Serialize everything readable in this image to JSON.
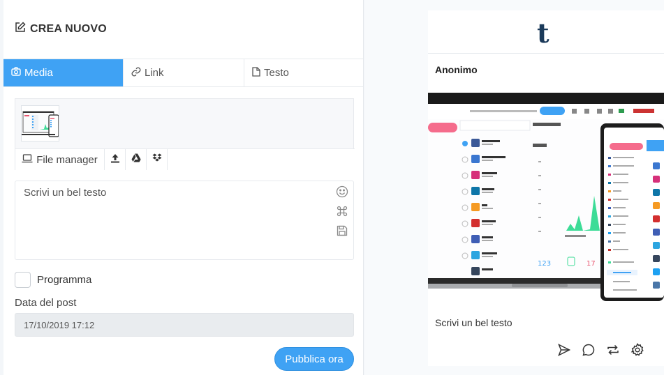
{
  "composer": {
    "title": "CREA NUOVO",
    "tabs": [
      {
        "label": "Media"
      },
      {
        "label": "Link"
      },
      {
        "label": "Testo"
      }
    ],
    "media_toolbar": {
      "file_manager_label": "File manager"
    },
    "text": {
      "value": "Scrivi un bel testo"
    },
    "schedule": {
      "label": "Programma",
      "checked": false
    },
    "date": {
      "label": "Data del post",
      "value": "17/10/2019 17:12"
    },
    "publish_label": "Pubblica ora"
  },
  "preview": {
    "network_logo": "t",
    "account_name": "Anonimo",
    "caption": "Scrivi un bel testo",
    "actions": [
      "send-icon",
      "comment-icon",
      "repost-icon",
      "settings-icon"
    ]
  },
  "colors": {
    "accent": "#3fa2f4",
    "tumblr_brand": "#1b3a5a"
  }
}
